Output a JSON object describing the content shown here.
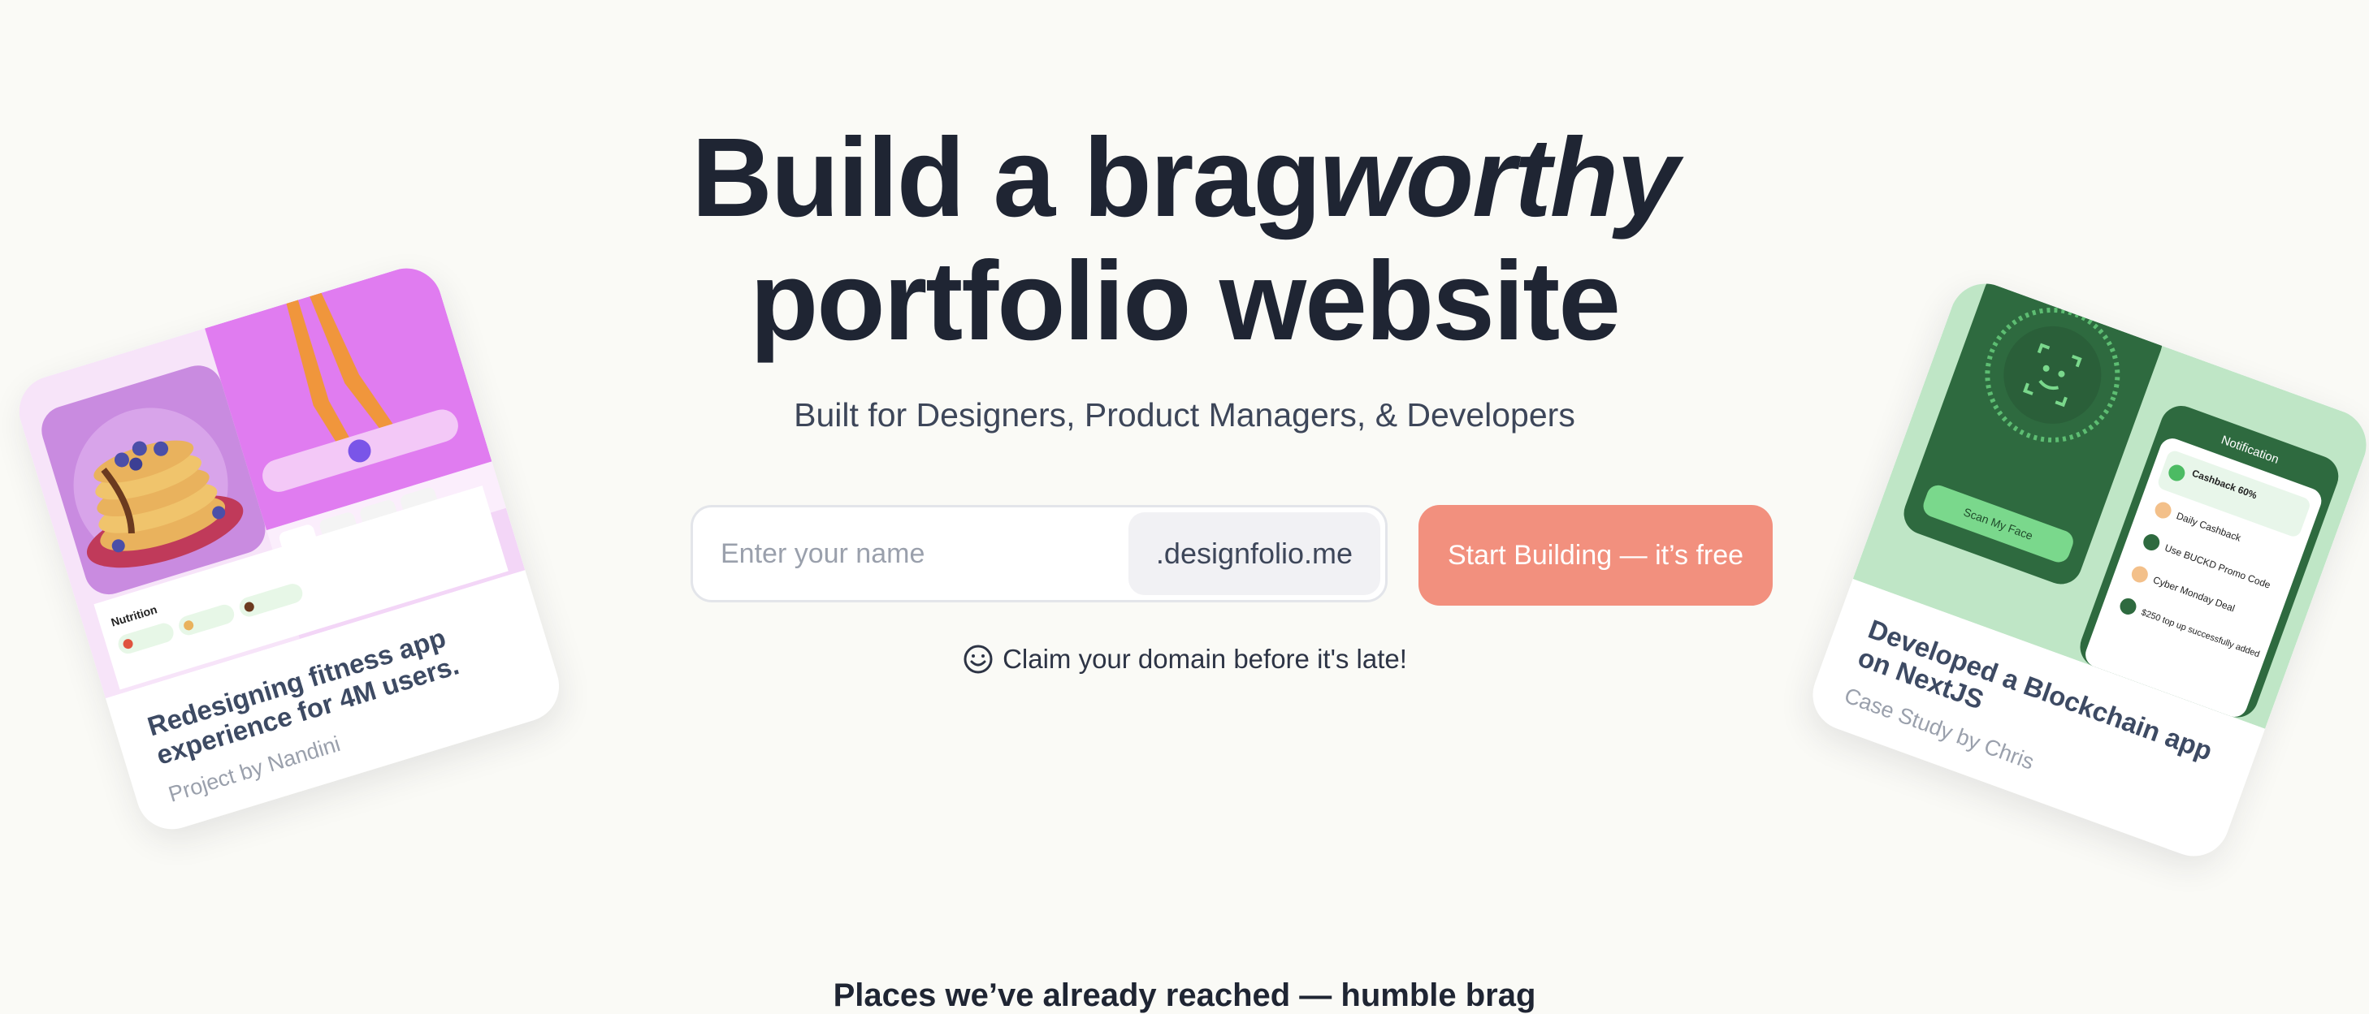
{
  "hero": {
    "title_line1_regular": "Build a brag",
    "title_line1_italic": "worthy",
    "title_line2": "portfolio website",
    "subtitle": "Built for Designers, Product Managers, & Developers"
  },
  "form": {
    "name_placeholder": "Enter your name",
    "domain_suffix": ".designfolio.me",
    "cta_label": "Start Building — it’s free"
  },
  "claim": {
    "text": "Claim your domain before it's late!",
    "icon": "smile-icon"
  },
  "places_heading": "Places we’ve already reached — humble brag",
  "cards": {
    "left": {
      "title": "Redesigning fitness app experience for 4M users.",
      "subtitle": "Project by Nandini",
      "mock": {
        "section_label": "Nutrition"
      }
    },
    "right": {
      "title": "Developed a Blockchain app on NextJS",
      "subtitle": "Case Study by Chris",
      "mock": {
        "header": "Notification",
        "scan_label": "Scan My Face",
        "rows": [
          "Cashback 60%",
          "Daily Cashback",
          "Use BUCKD Promo Code",
          "Cyber Monday Deal",
          "$250 top up successfully added"
        ]
      }
    }
  },
  "colors": {
    "background": "#fafaf6",
    "heading": "#1f2533",
    "cta": "#f2907e",
    "left_card_accent": "#e179ef",
    "right_card_accent": "#2e6a3f"
  }
}
